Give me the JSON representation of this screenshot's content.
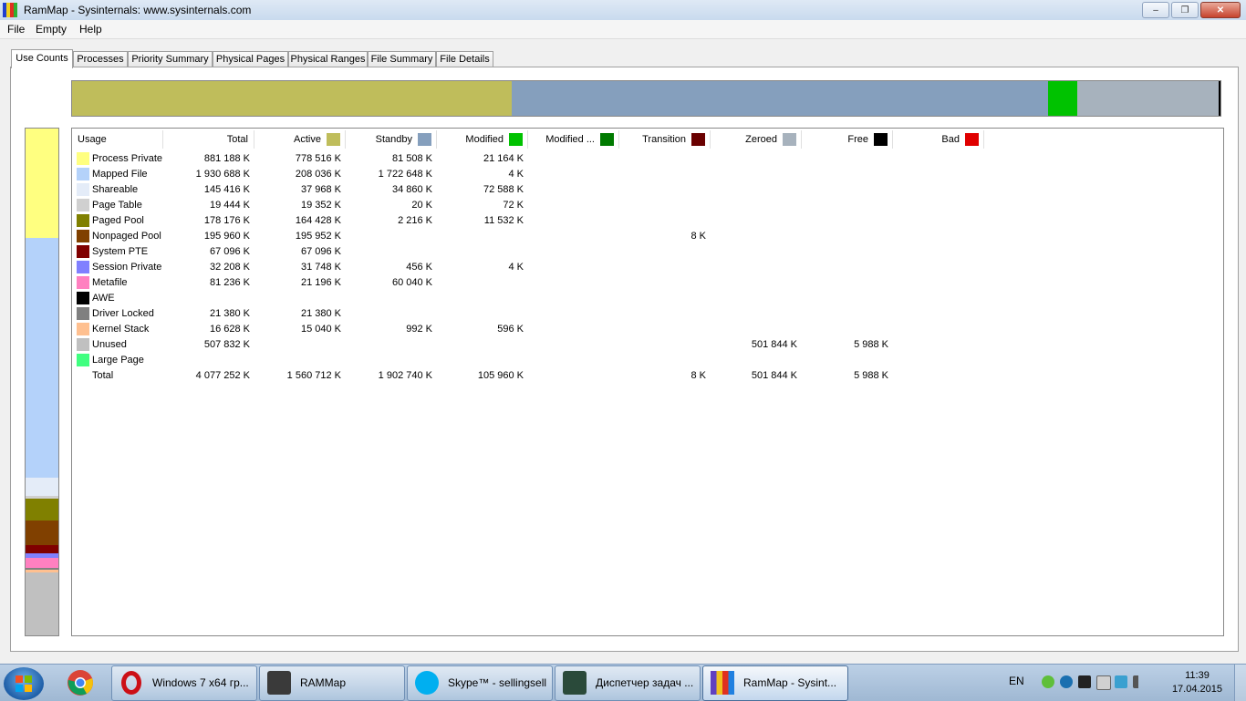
{
  "window": {
    "title": "RamMap - Sysinternals: www.sysinternals.com",
    "minimize": "–",
    "maximize": "❐",
    "close": "✕"
  },
  "menu": [
    "File",
    "Empty",
    "Help"
  ],
  "tabs": [
    "Use Counts",
    "Processes",
    "Priority Summary",
    "Physical Pages",
    "Physical Ranges",
    "File Summary",
    "File Details"
  ],
  "active_tab": "Use Counts",
  "colors": {
    "active": "#bfbd5b",
    "standby": "#859fbd",
    "modified": "#00c200",
    "modified_nowrite": "#007a00",
    "transition": "#6a0000",
    "zeroed": "#a7b2bd",
    "free": "#000000",
    "bad": "#e00000"
  },
  "columns": [
    {
      "label": "Usage",
      "swatch": ""
    },
    {
      "label": "Total",
      "swatch": ""
    },
    {
      "label": "Active",
      "swatch": "#bfbd5b"
    },
    {
      "label": "Standby",
      "swatch": "#859fbd"
    },
    {
      "label": "Modified",
      "swatch": "#00c200"
    },
    {
      "label": "Modified ...",
      "swatch": "#007a00"
    },
    {
      "label": "Transition",
      "swatch": "#6a0000"
    },
    {
      "label": "Zeroed",
      "swatch": "#a7b2bd"
    },
    {
      "label": "Free",
      "swatch": "#000000"
    },
    {
      "label": "Bad",
      "swatch": "#e00000"
    }
  ],
  "rows": [
    {
      "usage": "Process Private",
      "color": "#ffff80",
      "total": "881 188 K",
      "active": "778 516 K",
      "standby": "81 508 K",
      "modified": "21 164 K",
      "modified_nw": "",
      "transition": "",
      "zeroed": "",
      "free": "",
      "bad": ""
    },
    {
      "usage": "Mapped File",
      "color": "#b4d2fa",
      "total": "1 930 688 K",
      "active": "208 036 K",
      "standby": "1 722 648 K",
      "modified": "4 K",
      "modified_nw": "",
      "transition": "",
      "zeroed": "",
      "free": "",
      "bad": ""
    },
    {
      "usage": "Shareable",
      "color": "#e4ecf8",
      "total": "145 416 K",
      "active": "37 968 K",
      "standby": "34 860 K",
      "modified": "72 588 K",
      "modified_nw": "",
      "transition": "",
      "zeroed": "",
      "free": "",
      "bad": ""
    },
    {
      "usage": "Page Table",
      "color": "#d0d0d0",
      "total": "19 444 K",
      "active": "19 352 K",
      "standby": "20 K",
      "modified": "72 K",
      "modified_nw": "",
      "transition": "",
      "zeroed": "",
      "free": "",
      "bad": ""
    },
    {
      "usage": "Paged Pool",
      "color": "#808000",
      "total": "178 176 K",
      "active": "164 428 K",
      "standby": "2 216 K",
      "modified": "11 532 K",
      "modified_nw": "",
      "transition": "",
      "zeroed": "",
      "free": "",
      "bad": ""
    },
    {
      "usage": "Nonpaged Pool",
      "color": "#804000",
      "total": "195 960 K",
      "active": "195 952 K",
      "standby": "",
      "modified": "",
      "modified_nw": "",
      "transition": "8 K",
      "zeroed": "",
      "free": "",
      "bad": ""
    },
    {
      "usage": "System PTE",
      "color": "#800000",
      "total": "67 096 K",
      "active": "67 096 K",
      "standby": "",
      "modified": "",
      "modified_nw": "",
      "transition": "",
      "zeroed": "",
      "free": "",
      "bad": ""
    },
    {
      "usage": "Session Private",
      "color": "#8080ff",
      "total": "32 208 K",
      "active": "31 748 K",
      "standby": "456 K",
      "modified": "4 K",
      "modified_nw": "",
      "transition": "",
      "zeroed": "",
      "free": "",
      "bad": ""
    },
    {
      "usage": "Metafile",
      "color": "#ff80c0",
      "total": "81 236 K",
      "active": "21 196 K",
      "standby": "60 040 K",
      "modified": "",
      "modified_nw": "",
      "transition": "",
      "zeroed": "",
      "free": "",
      "bad": ""
    },
    {
      "usage": "AWE",
      "color": "#000000",
      "total": "",
      "active": "",
      "standby": "",
      "modified": "",
      "modified_nw": "",
      "transition": "",
      "zeroed": "",
      "free": "",
      "bad": ""
    },
    {
      "usage": "Driver Locked",
      "color": "#808080",
      "total": "21 380 K",
      "active": "21 380 K",
      "standby": "",
      "modified": "",
      "modified_nw": "",
      "transition": "",
      "zeroed": "",
      "free": "",
      "bad": ""
    },
    {
      "usage": "Kernel Stack",
      "color": "#ffc090",
      "total": "16 628 K",
      "active": "15 040 K",
      "standby": "992 K",
      "modified": "596 K",
      "modified_nw": "",
      "transition": "",
      "zeroed": "",
      "free": "",
      "bad": ""
    },
    {
      "usage": "Unused",
      "color": "#c0c0c0",
      "total": "507 832 K",
      "active": "",
      "standby": "",
      "modified": "",
      "modified_nw": "",
      "transition": "",
      "zeroed": "501 844 K",
      "free": "5 988 K",
      "bad": ""
    },
    {
      "usage": "Large Page",
      "color": "#40ff80",
      "total": "",
      "active": "",
      "standby": "",
      "modified": "",
      "modified_nw": "",
      "transition": "",
      "zeroed": "",
      "free": "",
      "bad": ""
    },
    {
      "usage": "Total",
      "color": "",
      "total": "4 077 252 K",
      "active": "1 560 712 K",
      "standby": "1 902 740 K",
      "modified": "105 960 K",
      "modified_nw": "",
      "transition": "8 K",
      "zeroed": "501 844 K",
      "free": "5 988 K",
      "bad": ""
    }
  ],
  "top_bar_segments": [
    {
      "name": "active",
      "color": "#bfbd5b",
      "fraction": 0.3828
    },
    {
      "name": "standby",
      "color": "#859fbd",
      "fraction": 0.4667
    },
    {
      "name": "modified",
      "color": "#00c200",
      "fraction": 0.026
    },
    {
      "name": "transition",
      "color": "#6a0000",
      "fraction": 0.0002
    },
    {
      "name": "zeroed",
      "color": "#a7b2bd",
      "fraction": 0.1231
    },
    {
      "name": "free",
      "color": "#000000",
      "fraction": 0.0015
    }
  ],
  "left_bar_segments": [
    {
      "name": "process-private",
      "color": "#ffff80",
      "fraction": 0.2161
    },
    {
      "name": "mapped-file",
      "color": "#b4d2fa",
      "fraction": 0.4735
    },
    {
      "name": "shareable",
      "color": "#e4ecf8",
      "fraction": 0.0357
    },
    {
      "name": "page-table",
      "color": "#d0d0d0",
      "fraction": 0.0048
    },
    {
      "name": "paged-pool",
      "color": "#808000",
      "fraction": 0.0437
    },
    {
      "name": "nonpaged-pool",
      "color": "#804000",
      "fraction": 0.0481
    },
    {
      "name": "system-pte",
      "color": "#800000",
      "fraction": 0.0165
    },
    {
      "name": "session-private",
      "color": "#8080ff",
      "fraction": 0.0079
    },
    {
      "name": "metafile",
      "color": "#ff80c0",
      "fraction": 0.0199
    },
    {
      "name": "driver-locked",
      "color": "#808080",
      "fraction": 0.0052
    },
    {
      "name": "kernel-stack",
      "color": "#ffc090",
      "fraction": 0.0041
    },
    {
      "name": "unused",
      "color": "#c0c0c0",
      "fraction": 0.1246
    }
  ],
  "taskbar": {
    "buttons": [
      {
        "label": "Windows 7 x64 гр...",
        "icon": "opera-icon",
        "color": "#cc0f16"
      },
      {
        "label": "RAMMap",
        "icon": "folder-window-icon",
        "color": "#3a3a3a"
      },
      {
        "label": "Skype™ - sellingsell",
        "icon": "skype-icon",
        "color": "#00aff0"
      },
      {
        "label": "Диспетчер задач ...",
        "icon": "task-manager-icon",
        "color": "#2a4a3a"
      },
      {
        "label": "RamMap - Sysint...",
        "icon": "rammap-icon",
        "color": "#6040c0"
      }
    ],
    "lang": "EN",
    "time": "11:39",
    "date": "17.04.2015"
  }
}
